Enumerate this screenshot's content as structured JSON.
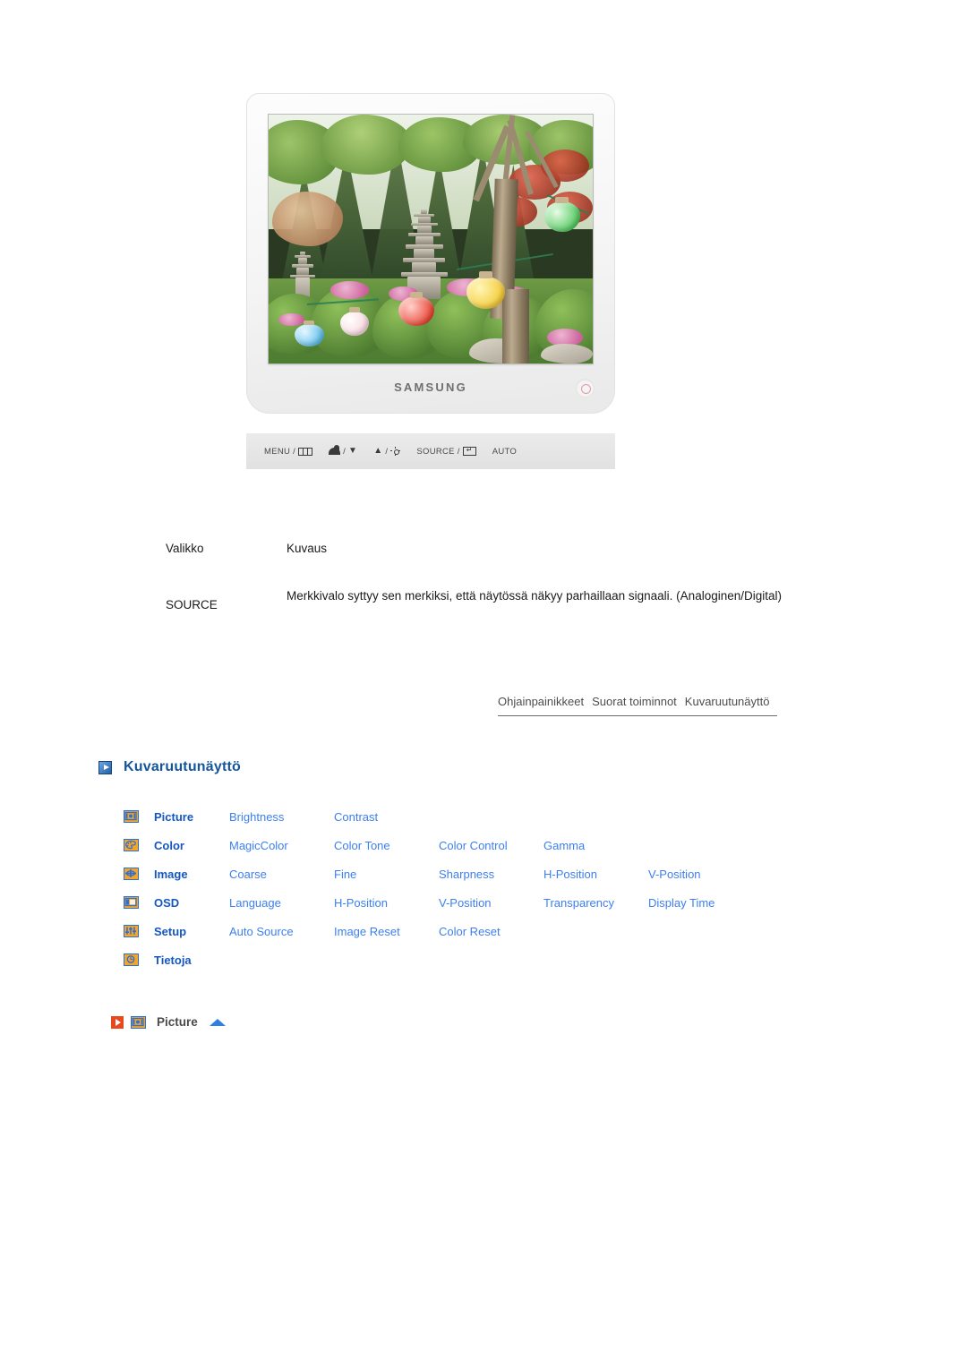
{
  "product": {
    "brand": "SAMSUNG",
    "photo_alt": "Korean temple garden with stone pagoda and paper lanterns"
  },
  "control_strip": {
    "buttons": [
      {
        "label": "MENU /",
        "icon": "menu-bars-icon"
      },
      {
        "label": "/",
        "icon_left": "magicbright-icon",
        "icon_right": "down-arrow-icon"
      },
      {
        "label": "/",
        "icon_left": "up-arrow-icon",
        "icon_right": "brightness-sun-icon"
      },
      {
        "label": "SOURCE /",
        "icon": "enter-key-icon"
      },
      {
        "label": "AUTO",
        "icon": ""
      }
    ],
    "power_indicator": "power-led-icon"
  },
  "desc_table": {
    "headers": {
      "menu": "Valikko",
      "description": "Kuvaus"
    },
    "rows": [
      {
        "menu": "SOURCE",
        "description": "Merkkivalo syttyy sen merkiksi, että näytössä näkyy parhaillaan signaali. (Analoginen/Digital)"
      }
    ]
  },
  "nav": {
    "links": [
      "Ohjainpainikkeet",
      "Suorat toiminnot",
      "Kuvaruutunäyttö"
    ]
  },
  "section": {
    "title": "Kuvaruutunäyttö",
    "icon": "blue-arrow-icon"
  },
  "menu_map": {
    "rows": [
      {
        "icon": "picture-icon",
        "name": "Picture",
        "items": [
          "Brightness",
          "Contrast"
        ]
      },
      {
        "icon": "color-palette-icon",
        "name": "Color",
        "items": [
          "MagicColor",
          "Color Tone",
          "Color Control",
          "Gamma"
        ]
      },
      {
        "icon": "image-icon",
        "name": "Image",
        "items": [
          "Coarse",
          "Fine",
          "Sharpness",
          "H-Position",
          "V-Position"
        ]
      },
      {
        "icon": "osd-icon",
        "name": "OSD",
        "items": [
          "Language",
          "H-Position",
          "V-Position",
          "Transparency",
          "Display Time"
        ]
      },
      {
        "icon": "setup-sliders-icon",
        "name": "Setup",
        "items": [
          "Auto Source",
          "Image Reset",
          "Color Reset"
        ]
      },
      {
        "icon": "information-clock-icon",
        "name": "Tietoja",
        "items": []
      }
    ]
  },
  "picture_marker": {
    "arrow_icon": "red-play-arrow-icon",
    "menu_icon": "picture-icon",
    "label": "Picture",
    "up_icon": "blue-up-triangle-icon"
  },
  "colors": {
    "heading_blue": "#14559c",
    "link_blue": "#3d7ff0",
    "name_blue": "#1557c0",
    "icon_amber": "#f0a52e",
    "marker_red": "#e8481c"
  }
}
